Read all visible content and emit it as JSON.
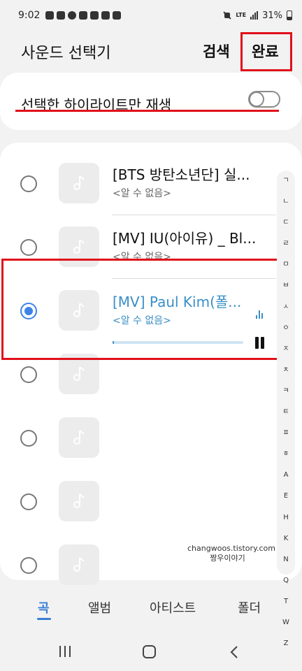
{
  "status_bar": {
    "time": "9:02",
    "network": "LTE",
    "battery": "31%"
  },
  "header": {
    "title": "사운드 선택기",
    "search_label": "검색",
    "done_label": "완료"
  },
  "highlight": {
    "label": "선택한 하이라이트만 재생",
    "toggle_on": false
  },
  "list": {
    "items": [
      {
        "title": "[BTS 방탄소년단] 실...",
        "subtitle": "<알 수 없음>",
        "selected": false
      },
      {
        "title": "[MV] IU(아이유) _ Bl...",
        "subtitle": "<알 수 없음>",
        "selected": false
      },
      {
        "title": "[MV] Paul Kim(폴...",
        "subtitle": "<알 수 없음>",
        "selected": true,
        "progress": 0.01
      },
      {
        "title": "",
        "subtitle": "",
        "selected": false
      },
      {
        "title": "",
        "subtitle": "",
        "selected": false
      },
      {
        "title": "",
        "subtitle": "",
        "selected": false
      },
      {
        "title": "",
        "subtitle": "",
        "selected": false
      }
    ]
  },
  "index_letters": [
    "ㄱ",
    "ㄴ",
    "ㄷ",
    "ㄹ",
    "ㅁ",
    "ㅂ",
    "ㅅ",
    "ㅇ",
    "ㅈ",
    "ㅊ",
    "ㅋ",
    "ㅌ",
    "ㅍ",
    "ㅎ",
    "A",
    "E",
    "H",
    "K",
    "N",
    "Q",
    "T",
    "W",
    "Z"
  ],
  "watermark": {
    "line1": "changwoos.tistory.com",
    "line2": "짱우이야기"
  },
  "tabs": [
    {
      "label": "곡",
      "active": true
    },
    {
      "label": "앨범",
      "active": false
    },
    {
      "label": "아티스트",
      "active": false
    },
    {
      "label": "폴더",
      "active": false
    }
  ],
  "colors": {
    "accent": "#3a7fd6",
    "annotation_red": "#e0101a",
    "playing_text": "#3a8fc7"
  }
}
